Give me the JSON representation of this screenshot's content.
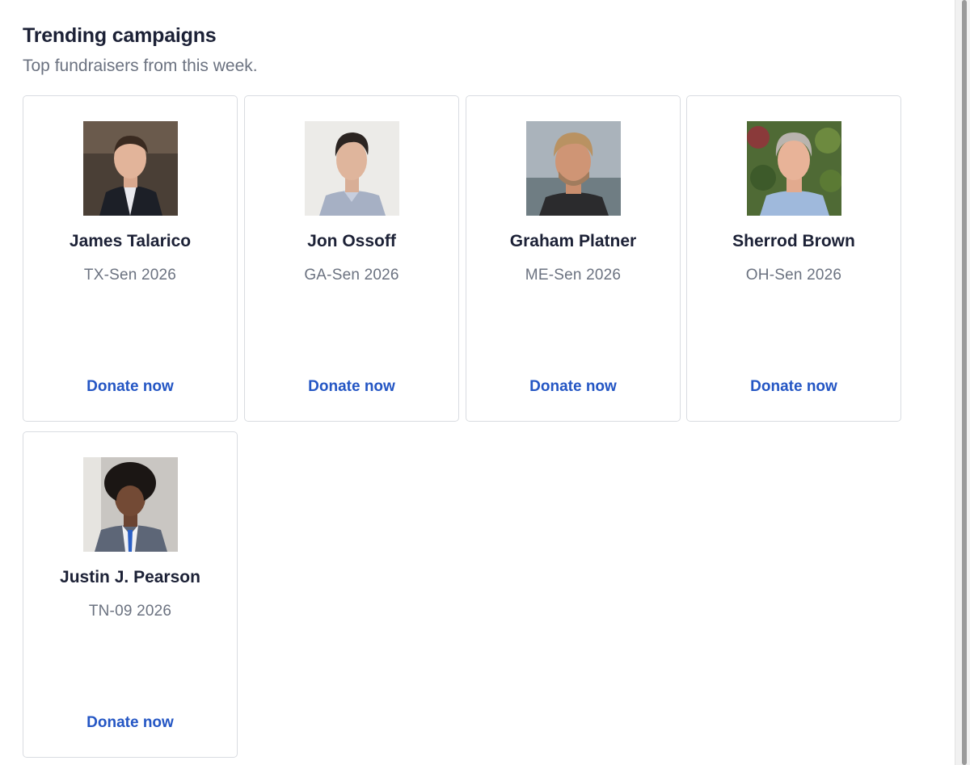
{
  "header": {
    "title": "Trending campaigns",
    "subtitle": "Top fundraisers from this week."
  },
  "campaigns": [
    {
      "name": "James Talarico",
      "race": "TX-Sen 2026",
      "cta": "Donate now"
    },
    {
      "name": "Jon Ossoff",
      "race": "GA-Sen 2026",
      "cta": "Donate now"
    },
    {
      "name": "Graham Platner",
      "race": "ME-Sen 2026",
      "cta": "Donate now"
    },
    {
      "name": "Sherrod Brown",
      "race": "OH-Sen 2026",
      "cta": "Donate now"
    },
    {
      "name": "Justin J. Pearson",
      "race": "TN-09 2026",
      "cta": "Donate now"
    }
  ],
  "colors": {
    "heading": "#1c2136",
    "muted": "#6b7280",
    "link": "#2456c4",
    "card_border": "#d9dce1"
  }
}
